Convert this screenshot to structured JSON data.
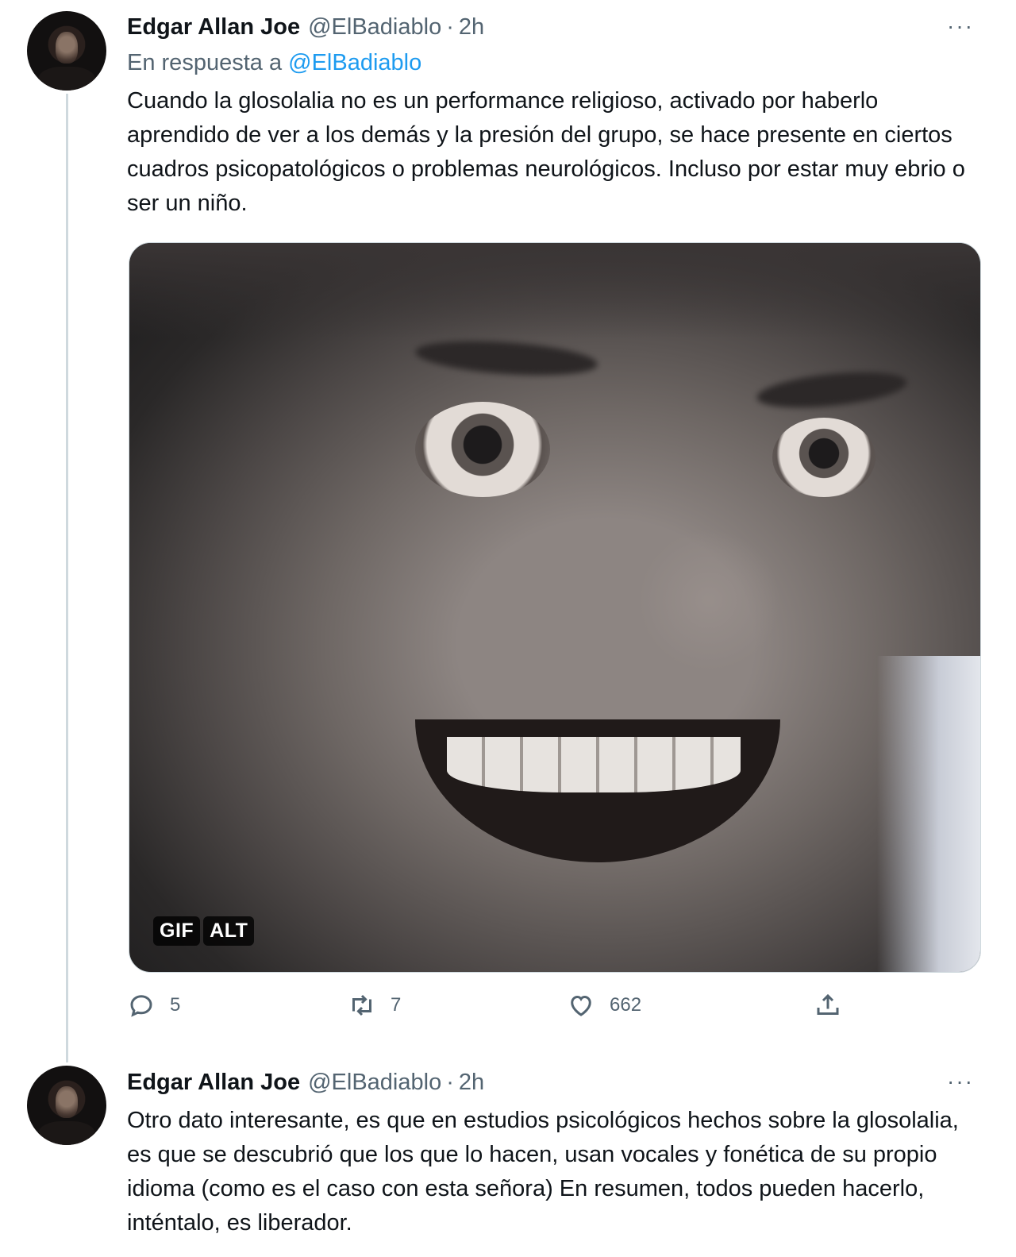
{
  "tweets": [
    {
      "author_name": "Edgar Allan Joe",
      "handle": "@ElBadiablo",
      "separator": "·",
      "time": "2h",
      "more_label": "···",
      "reply_prefix": "En respuesta a",
      "reply_mention": "@ElBadiablo",
      "text": "Cuando la glosolalia no es un performance religioso, activado por haberlo aprendido de ver a los demás y la presión del grupo, se hace presente en ciertos cuadros psicopatológicos o problemas neurológicos. Incluso por estar muy ebrio o ser un niño.",
      "media": {
        "badge_gif": "GIF",
        "badge_alt": "ALT"
      },
      "actions": {
        "replies": "5",
        "retweets": "7",
        "likes": "662"
      }
    },
    {
      "author_name": "Edgar Allan Joe",
      "handle": "@ElBadiablo",
      "separator": "·",
      "time": "2h",
      "more_label": "···",
      "text": "Otro dato interesante, es que en estudios psicológicos hechos sobre la glosolalia, es que se descubrió que los que lo hacen, usan vocales y fonética de su propio idioma (como es el caso con esta señora) En resumen, todos pueden hacerlo, inténtalo, es liberador."
    }
  ],
  "icons": {
    "reply": "reply-icon",
    "retweet": "retweet-icon",
    "like": "heart-icon",
    "share": "share-icon"
  },
  "colors": {
    "text": "#0f1419",
    "secondary": "#536471",
    "link": "#1d9bf0",
    "divider": "#cfd9de"
  }
}
